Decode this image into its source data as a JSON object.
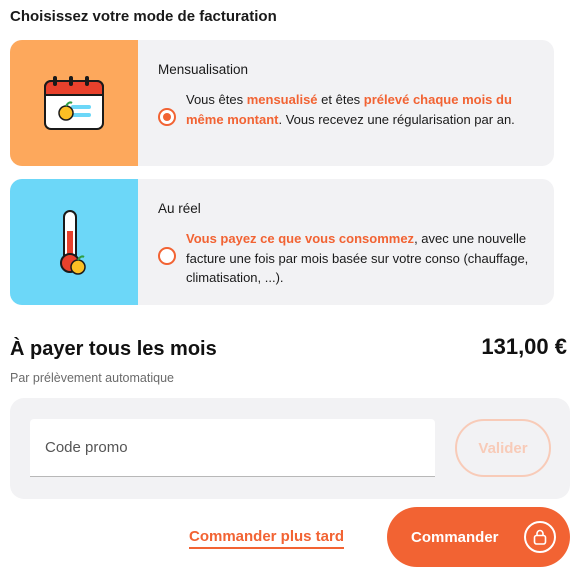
{
  "billing": {
    "title": "Choisissez votre mode de facturation",
    "options": [
      {
        "id": "monthly",
        "title": "Mensualisation",
        "selected": true,
        "desc_parts": [
          "Vous êtes ",
          "mensualisé",
          " et êtes ",
          "prélevé chaque mois du même montant",
          ". Vous recevez une régularisation par an."
        ],
        "illustration": "calendar-icon"
      },
      {
        "id": "real",
        "title": "Au réel",
        "selected": false,
        "desc_parts": [
          "Vous payez ce que vous consommez",
          ", avec une nouvelle facture une fois par mois basée sur votre conso (chauffage, climatisation, ...)."
        ],
        "illustration": "thermometer-icon"
      }
    ]
  },
  "payment": {
    "title": "À payer tous les mois",
    "amount": "131,00 €",
    "subtitle": "Par prélèvement automatique"
  },
  "promo": {
    "placeholder": "Code promo",
    "validate_label": "Valider"
  },
  "actions": {
    "later_label": "Commander plus tard",
    "order_label": "Commander"
  },
  "colors": {
    "accent": "#f26333",
    "orange_panel": "#fda85c",
    "blue_panel": "#6cd7f8",
    "card_bg": "#f2f2f4"
  }
}
